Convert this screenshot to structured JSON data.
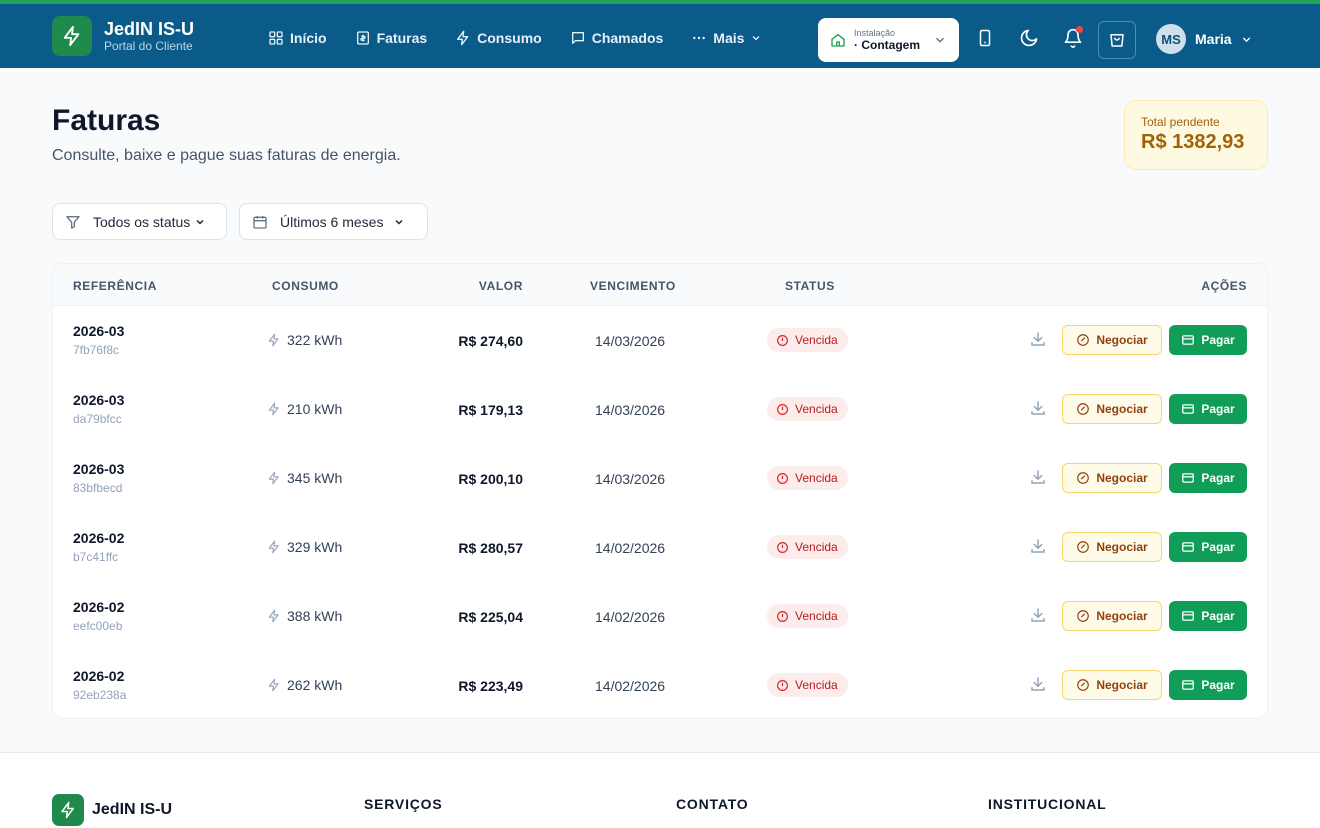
{
  "header": {
    "brand_title": "JedIN IS-U",
    "brand_subtitle": "Portal do Cliente",
    "nav": [
      {
        "label": "Início",
        "icon": "grid-icon"
      },
      {
        "label": "Faturas",
        "icon": "receipt-icon"
      },
      {
        "label": "Consumo",
        "icon": "bolt-icon"
      },
      {
        "label": "Chamados",
        "icon": "chat-icon"
      },
      {
        "label": "Mais",
        "icon": "dots-icon"
      }
    ],
    "installation_label": "Instalação",
    "installation_value": "· Contagem",
    "user_initials": "MS",
    "user_name": "Maria"
  },
  "page": {
    "title": "Faturas",
    "subtitle": "Consulte, baixe e pague suas faturas de energia.",
    "total_label": "Total pendente",
    "total_value": "R$ 1382,93"
  },
  "filters": {
    "status": "Todos os status",
    "period": "Últimos 6 meses"
  },
  "table": {
    "headers": {
      "reference": "REFERÊNCIA",
      "consumption": "CONSUMO",
      "value": "VALOR",
      "due": "VENCIMENTO",
      "status": "STATUS",
      "actions": "AÇÕES"
    },
    "negotiate_label": "Negociar",
    "pay_label": "Pagar",
    "rows": [
      {
        "ref": "2026-03",
        "id": "7fb76f8c",
        "consumption": "322 kWh",
        "value": "R$ 274,60",
        "due": "14/03/2026",
        "status": "Vencida"
      },
      {
        "ref": "2026-03",
        "id": "da79bfcc",
        "consumption": "210 kWh",
        "value": "R$ 179,13",
        "due": "14/03/2026",
        "status": "Vencida"
      },
      {
        "ref": "2026-03",
        "id": "83bfbecd",
        "consumption": "345 kWh",
        "value": "R$ 200,10",
        "due": "14/03/2026",
        "status": "Vencida"
      },
      {
        "ref": "2026-02",
        "id": "b7c41ffc",
        "consumption": "329 kWh",
        "value": "R$ 280,57",
        "due": "14/02/2026",
        "status": "Vencida"
      },
      {
        "ref": "2026-02",
        "id": "eefc00eb",
        "consumption": "388 kWh",
        "value": "R$ 225,04",
        "due": "14/02/2026",
        "status": "Vencida"
      },
      {
        "ref": "2026-02",
        "id": "92eb238a",
        "consumption": "262 kWh",
        "value": "R$ 223,49",
        "due": "14/02/2026",
        "status": "Vencida"
      }
    ]
  },
  "footer": {
    "brand": "JedIN IS-U",
    "col1": "SERVIÇOS",
    "col2": "CONTATO",
    "col3": "INSTITUCIONAL"
  },
  "colors": {
    "header_bg": "#0b5b8a",
    "accent_green": "#0f9d58",
    "overdue_red": "#b91c1c",
    "pending_amber": "#a16207"
  }
}
